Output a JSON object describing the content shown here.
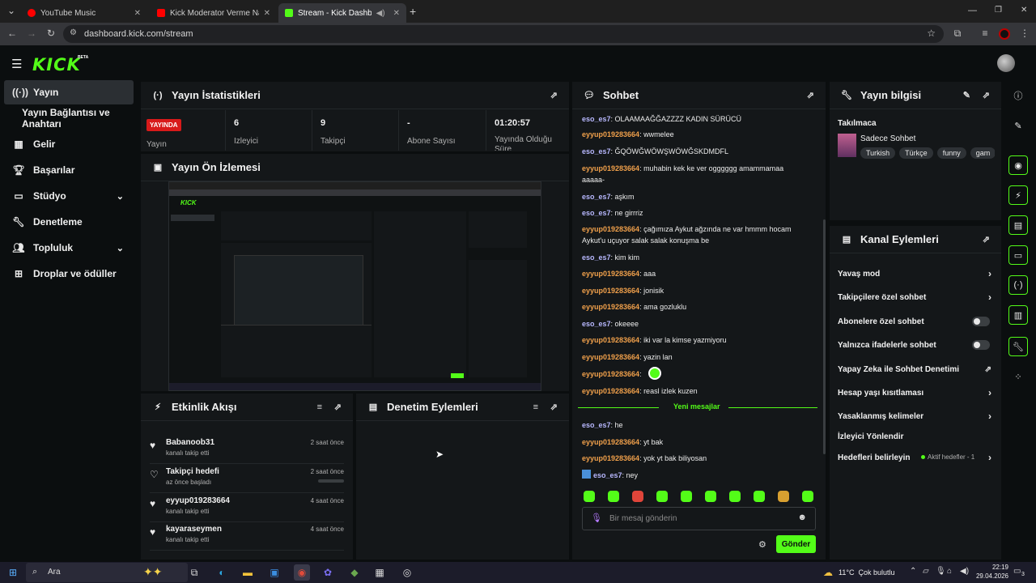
{
  "browser": {
    "tabs": [
      {
        "title": "YouTube Music",
        "fav_color": "#ff0000"
      },
      {
        "title": "Kick Moderator Verme Nasıl Yap",
        "fav_color": "#ff0000"
      },
      {
        "title": "Stream - Kick Dashboard",
        "fav_color": "#53fc18"
      }
    ],
    "url": "dashboard.kick.com/stream",
    "new_tab": "+"
  },
  "brand": {
    "logo": "KICK",
    "badge": "BETA"
  },
  "sidebar": {
    "items": [
      {
        "label": "Yayın",
        "icon": "broadcast-icon"
      },
      {
        "label": "Yayın Bağlantısı ve Anahtarı",
        "icon": ""
      },
      {
        "label": "Gelir",
        "icon": "revenue-icon"
      },
      {
        "label": "Başarılar",
        "icon": "trophy-icon"
      },
      {
        "label": "Stüdyo",
        "icon": "studio-icon"
      },
      {
        "label": "Denetleme",
        "icon": "wrench-icon"
      },
      {
        "label": "Topluluk",
        "icon": "community-icon"
      },
      {
        "label": "Droplar ve ödüller",
        "icon": "drops-icon"
      }
    ]
  },
  "stats": {
    "title": "Yayın İstatistikleri",
    "live_badge": "YAYINDA",
    "live_label": "Yayın",
    "cells": [
      {
        "value": "6",
        "label": "İzleyici"
      },
      {
        "value": "9",
        "label": "Takipçi"
      },
      {
        "value": "-",
        "label": "Abone Sayısı"
      },
      {
        "value": "01:20:57",
        "label": "Yayında Olduğu Süre"
      }
    ]
  },
  "preview": {
    "title": "Yayın Ön İzlemesi"
  },
  "activity": {
    "title": "Etkinlik Akışı",
    "items": [
      {
        "name": "Babanoob31",
        "sub": "kanalı takip etti",
        "time": "2 saat önce",
        "icon": "heart-icon"
      },
      {
        "name": "Takipçi hedefi",
        "sub": "az önce başladı",
        "time": "2 saat önce",
        "icon": "heart-outline-icon"
      },
      {
        "name": "eyyup019283664",
        "sub": "kanalı takip etti",
        "time": "4 saat önce",
        "icon": "heart-icon"
      },
      {
        "name": "kayaraseymen",
        "sub": "kanalı takip etti",
        "time": "4 saat önce",
        "icon": "heart-icon"
      }
    ]
  },
  "moderation": {
    "title": "Denetim Eylemleri"
  },
  "chat": {
    "title": "Sohbet",
    "messages": [
      {
        "user": "eso_es7",
        "text": ": OLAAMAAĞĞAZZZZ KADIN SÜRÜCÜ",
        "kind": "u1"
      },
      {
        "user": "eyyup019283664",
        "text": ": wwmelee",
        "kind": "u2"
      },
      {
        "user": "eso_es7",
        "text": ": ĞQÖWĞWÖWŞWÖWĞSKDMDFL",
        "kind": "u1"
      },
      {
        "user": "eyyup019283664",
        "text": ": muhabin kek ke ver ogggggg amammamaa aaaaa-",
        "kind": "u2"
      },
      {
        "user": "eso_es7",
        "text": ": aşkım",
        "kind": "u1"
      },
      {
        "user": "eso_es7",
        "text": ": ne girrriz",
        "kind": "u1"
      },
      {
        "user": "eyyup019283664",
        "text": ": çağımıza Aykut ağzında ne var hmmm hocam Aykut'u uçuyor salak salak konuşma be",
        "kind": "u2"
      },
      {
        "user": "eso_es7",
        "text": ": kim kim",
        "kind": "u1"
      },
      {
        "user": "eyyup019283664",
        "text": ": aaa",
        "kind": "u2"
      },
      {
        "user": "eyyup019283664",
        "text": ": jonisik",
        "kind": "u2"
      },
      {
        "user": "eyyup019283664",
        "text": ": ama gozluklu",
        "kind": "u2"
      },
      {
        "user": "eso_es7",
        "text": ": okeeee",
        "kind": "u1"
      },
      {
        "user": "eyyup019283664",
        "text": ": iki var la kimse yazmiyoru",
        "kind": "u2"
      },
      {
        "user": "eyyup019283664",
        "text": ": yazin lan",
        "kind": "u2"
      },
      {
        "user": "eyyup019283664",
        "text": ":",
        "kind": "u2"
      },
      {
        "user": "eyyup019283664",
        "text": ": reasl izlek kuzen",
        "kind": "u2"
      }
    ],
    "new_messages": "Yeni mesajlar",
    "new": [
      {
        "user": "eso_es7",
        "text": ": he",
        "kind": "u1"
      },
      {
        "user": "eyyup019283664",
        "text": ": yt bak",
        "kind": "u2"
      },
      {
        "user": "eyyup019283664",
        "text": ": yok yt bak biliyosan",
        "kind": "u2"
      },
      {
        "user": "eso_es7",
        "text": ": ney",
        "kind": "u1"
      }
    ],
    "placeholder": "Bir mesaj gönderin",
    "send": "Gönder"
  },
  "stream_info": {
    "title": "Yayın bilgisi",
    "category_label": "Takılmaca",
    "category": "Sadece Sohbet",
    "tags": [
      "Turkish",
      "Türkçe",
      "funny",
      "gam"
    ]
  },
  "channel_actions": {
    "title": "Kanal Eylemleri",
    "items": [
      {
        "label": "Yavaş mod",
        "type": "chevron"
      },
      {
        "label": "Takipçilere özel sohbet",
        "type": "chevron"
      },
      {
        "label": "Abonelere özel sohbet",
        "type": "toggle"
      },
      {
        "label": "Yalnızca ifadelerle sohbet",
        "type": "toggle"
      },
      {
        "label": "Yapay Zeka ile Sohbet Denetimi",
        "type": "external"
      },
      {
        "label": "Hesap yaşı kısıtlaması",
        "type": "chevron"
      },
      {
        "label": "Yasaklanmış kelimeler",
        "type": "chevron"
      },
      {
        "label": "İzleyici Yönlendir",
        "type": "none"
      },
      {
        "label": "Hedefleri belirleyin",
        "type": "goal"
      }
    ],
    "goal_status": "Aktif hedefler - 1"
  },
  "taskbar": {
    "search": "Ara",
    "weather": "11°C  Çok bulutlu",
    "time": "22:19",
    "date": "29.04.2026",
    "notif": "3"
  },
  "colors": {
    "accent": "#53fc18",
    "panel": "#141719",
    "bg": "#0b0e0f"
  }
}
